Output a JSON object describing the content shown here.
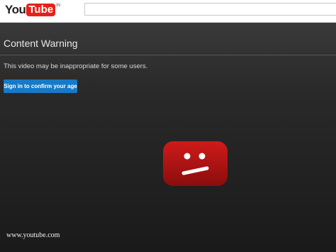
{
  "header": {
    "logo_you": "You",
    "logo_tube": "Tube",
    "logo_region": "IN",
    "search_placeholder": ""
  },
  "warning": {
    "title": "Content Warning",
    "message": "This video may be inappropriate for some users.",
    "signin_label": "Sign in to confirm your age"
  },
  "icon": {
    "name": "sad-face-play-icon"
  },
  "watermark": "www.youtube.com",
  "colors": {
    "brand_red": "#e62117",
    "button_blue": "#167ac6",
    "background": "#1b1b1b"
  }
}
